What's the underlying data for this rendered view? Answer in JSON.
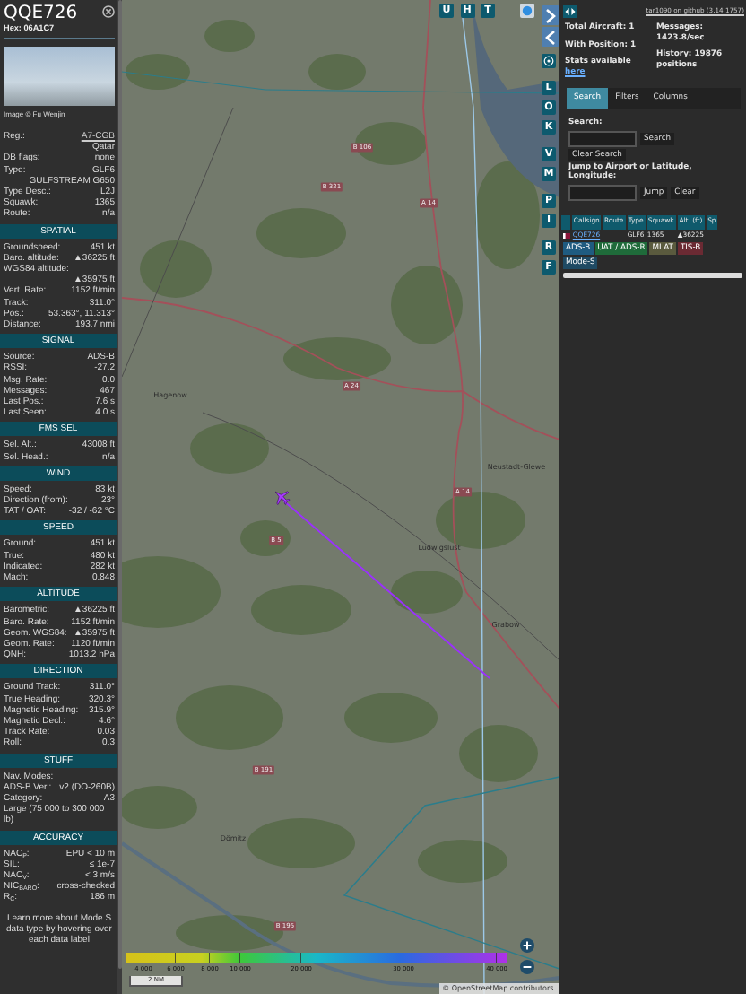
{
  "detail": {
    "callsign": "QQE726",
    "hex": "Hex: 06A1C7",
    "photo_credit": "Image © Fu Wenjin",
    "general": [
      {
        "kind": "link",
        "label": "Reg.:",
        "value": "A7-CGB"
      },
      {
        "kind": "value",
        "value": "Qatar"
      },
      {
        "kind": "pair",
        "label": "DB flags:",
        "value": "none"
      },
      {
        "kind": "pair",
        "label": "Type:",
        "value": "GLF6"
      },
      {
        "kind": "value",
        "value": "GULFSTREAM G650"
      },
      {
        "kind": "pair",
        "label": "Type Desc.:",
        "value": "L2J"
      },
      {
        "kind": "pair",
        "label": "Squawk:",
        "value": "1365"
      },
      {
        "kind": "pair",
        "label": "Route:",
        "value": "n/a"
      }
    ],
    "sections": [
      {
        "title": "SPATIAL",
        "rows": [
          {
            "kind": "pair",
            "label": "Groundspeed:",
            "value": "451 kt"
          },
          {
            "kind": "pair",
            "label": "Baro. altitude:",
            "value": "▲36225 ft"
          },
          {
            "kind": "label",
            "label": "WGS84 altitude:"
          },
          {
            "kind": "value",
            "value": "▲35975 ft"
          },
          {
            "kind": "pair",
            "label": "Vert. Rate:",
            "value": "1152 ft/min"
          },
          {
            "kind": "pair",
            "label": "Track:",
            "value": "311.0°"
          },
          {
            "kind": "pair",
            "label": "Pos.:",
            "value": "53.363°, 11.313°"
          },
          {
            "kind": "pair",
            "label": "Distance:",
            "value": "193.7 nmi"
          }
        ]
      },
      {
        "title": "SIGNAL",
        "rows": [
          {
            "kind": "pair",
            "label": "Source:",
            "value": "ADS-B"
          },
          {
            "kind": "pair",
            "label": "RSSI:",
            "value": "-27.2"
          },
          {
            "kind": "pair",
            "label": "Msg. Rate:",
            "value": "0.0"
          },
          {
            "kind": "pair",
            "label": "Messages:",
            "value": "467"
          },
          {
            "kind": "pair",
            "label": "Last Pos.:",
            "value": "7.6 s"
          },
          {
            "kind": "pair",
            "label": "Last Seen:",
            "value": "4.0 s"
          }
        ]
      },
      {
        "title": "FMS SEL",
        "rows": [
          {
            "kind": "pair",
            "label": "Sel. Alt.:",
            "value": "43008 ft"
          },
          {
            "kind": "pair",
            "label": "Sel. Head.:",
            "value": "n/a"
          }
        ]
      },
      {
        "title": "WIND",
        "rows": [
          {
            "kind": "pair",
            "label": "Speed:",
            "value": "83 kt"
          },
          {
            "kind": "pair",
            "label": "Direction (from):",
            "value": "23°"
          },
          {
            "kind": "pair",
            "label": "TAT / OAT:",
            "value": "-32 / -62 °C"
          }
        ]
      },
      {
        "title": "SPEED",
        "rows": [
          {
            "kind": "pair",
            "label": "Ground:",
            "value": "451 kt"
          },
          {
            "kind": "pair",
            "label": "True:",
            "value": "480 kt"
          },
          {
            "kind": "pair",
            "label": "Indicated:",
            "value": "282 kt"
          },
          {
            "kind": "pair",
            "label": "Mach:",
            "value": "0.848"
          }
        ]
      },
      {
        "title": "ALTITUDE",
        "rows": [
          {
            "kind": "pair",
            "label": "Barometric:",
            "value": "▲36225 ft"
          },
          {
            "kind": "pair",
            "label": "Baro. Rate:",
            "value": "1152 ft/min"
          },
          {
            "kind": "pair",
            "label": "Geom. WGS84:",
            "value": "▲35975 ft"
          },
          {
            "kind": "pair",
            "label": "Geom. Rate:",
            "value": "1120 ft/min"
          },
          {
            "kind": "pair",
            "label": "QNH:",
            "value": "1013.2 hPa"
          }
        ]
      },
      {
        "title": "DIRECTION",
        "rows": [
          {
            "kind": "pair",
            "label": "Ground Track:",
            "value": "311.0°"
          },
          {
            "kind": "pair",
            "label": "True Heading:",
            "value": "320.3°"
          },
          {
            "kind": "pair",
            "label": "Magnetic Heading:",
            "value": "315.9°"
          },
          {
            "kind": "pair",
            "label": "Magnetic Decl.:",
            "value": "4.6°"
          },
          {
            "kind": "pair",
            "label": "Track Rate:",
            "value": "0.03"
          },
          {
            "kind": "pair",
            "label": "Roll:",
            "value": "0.3"
          }
        ]
      },
      {
        "title": "STUFF",
        "rows": [
          {
            "kind": "label",
            "label": "Nav. Modes:"
          },
          {
            "kind": "pair",
            "label": "ADS-B Ver.:",
            "value": "v2 (DO-260B)"
          },
          {
            "kind": "pair",
            "label": "Category:",
            "value": "A3"
          },
          {
            "kind": "note",
            "label": "Large (75 000 to 300 000 lb)"
          }
        ]
      },
      {
        "title": "ACCURACY",
        "rows": [
          {
            "kind": "pair",
            "label": "NAC$_{P}$:",
            "value": "EPU < 10 m"
          },
          {
            "kind": "pair",
            "label": "SIL:",
            "value": "≤ 1e-7"
          },
          {
            "kind": "pair",
            "label": "NAC$_{V}$:",
            "value": "< 3 m/s"
          },
          {
            "kind": "pair",
            "label": "NIC$_{BARO}$:",
            "value": "cross-checked"
          },
          {
            "kind": "pair",
            "label": "R$_{C}$:",
            "value": "186 m"
          }
        ]
      }
    ],
    "note": "Learn more about Mode S data type by hovering over each data label"
  },
  "map": {
    "top_buttons": [
      "U",
      "H",
      "T"
    ],
    "button_groups": [
      [
        "L",
        "O",
        "K"
      ],
      [
        "V",
        "M"
      ],
      [
        "P",
        "I"
      ],
      [
        "R",
        "F"
      ]
    ],
    "places": [
      "Hagenow",
      "Neustadt-Glewe",
      "Ludwigslust",
      "Grabow",
      "Dömitz"
    ],
    "roads": [
      "B 106",
      "B 321",
      "A 14",
      "A 24",
      "A 14",
      "B 5",
      "B 191",
      "B 195"
    ],
    "legend": [
      "4 000",
      "6 000",
      "8 000",
      "10 000",
      "20 000",
      "30 000",
      "40 000"
    ],
    "scale": "2 NM",
    "attribution": "© OpenStreetMap contributors."
  },
  "side": {
    "github_link": "tar1090 on github (3.14.1757)",
    "stats_left": [
      "Total Aircraft: 1",
      "With Position: 1"
    ],
    "stats_right": [
      "Messages: 1423.8/sec",
      "History: 19876 positions"
    ],
    "stats_note": "Stats available",
    "stats_link": "here",
    "tabs": [
      {
        "label": "Search",
        "selected": true
      },
      {
        "label": "Filters",
        "selected": false
      },
      {
        "label": "Columns",
        "selected": false
      }
    ],
    "search_label": "Search:",
    "search_button": "Search",
    "clear_search": "Clear Search",
    "jump_label": "Jump to Airport or Latitude, Longitude:",
    "jump_button": "Jump",
    "jump_clear": "Clear",
    "columns": [
      "Callsign",
      "Route",
      "Type",
      "Squawk",
      "Alt. (ft)",
      "Sp"
    ],
    "rows": [
      {
        "callsign": "QQE726",
        "type": "GLF6",
        "squawk": "1365",
        "altitude": "▲36225"
      }
    ],
    "badges": [
      {
        "label": "ADS-B",
        "color": "#1f5b80"
      },
      {
        "label": "UAT / ADS-R",
        "color": "#1f6b3a"
      },
      {
        "label": "MLAT",
        "color": "#5a5a3e"
      },
      {
        "label": "TIS-B",
        "color": "#6b2a33"
      },
      {
        "label": "Mode-S",
        "color": "#1f4a63"
      }
    ]
  }
}
